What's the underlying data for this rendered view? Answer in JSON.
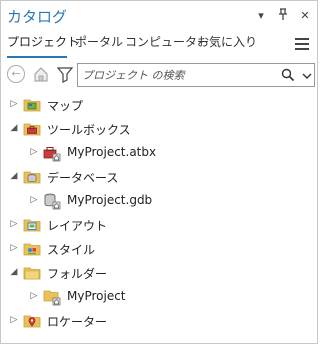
{
  "panel": {
    "title": "カタログ",
    "dropdown_glyph": "▾",
    "pin_glyph": "ꟸ",
    "close_glyph": "✕"
  },
  "tabs": [
    {
      "label": "プロジェクト",
      "active": true
    },
    {
      "label": "ポータル",
      "active": false
    },
    {
      "label": "コンピューター",
      "active": false
    },
    {
      "label": "お気に入り",
      "active": false
    }
  ],
  "search": {
    "placeholder": "プロジェクト の検索",
    "back_glyph": "←"
  },
  "tree": [
    {
      "label": "マップ",
      "expanded": false,
      "level": 0,
      "icon": "map-folder-icon"
    },
    {
      "label": "ツールボックス",
      "expanded": true,
      "level": 0,
      "icon": "toolbox-folder-icon"
    },
    {
      "label": "MyProject.atbx",
      "expanded": false,
      "level": 1,
      "icon": "toolbox-icon"
    },
    {
      "label": "データベース",
      "expanded": true,
      "level": 0,
      "icon": "database-folder-icon"
    },
    {
      "label": "MyProject.gdb",
      "expanded": false,
      "level": 1,
      "icon": "geodatabase-icon"
    },
    {
      "label": "レイアウト",
      "expanded": false,
      "level": 0,
      "icon": "layout-folder-icon"
    },
    {
      "label": "スタイル",
      "expanded": false,
      "level": 0,
      "icon": "style-folder-icon"
    },
    {
      "label": "フォルダー",
      "expanded": true,
      "level": 0,
      "icon": "folder-connection-icon"
    },
    {
      "label": "MyProject",
      "expanded": false,
      "level": 1,
      "icon": "home-folder-icon"
    },
    {
      "label": "ロケーター",
      "expanded": false,
      "level": 0,
      "icon": "locator-folder-icon"
    }
  ],
  "colors": {
    "accent": "#2a77b8",
    "folder": "#e8c15a",
    "folder_dark": "#c9a13a"
  }
}
